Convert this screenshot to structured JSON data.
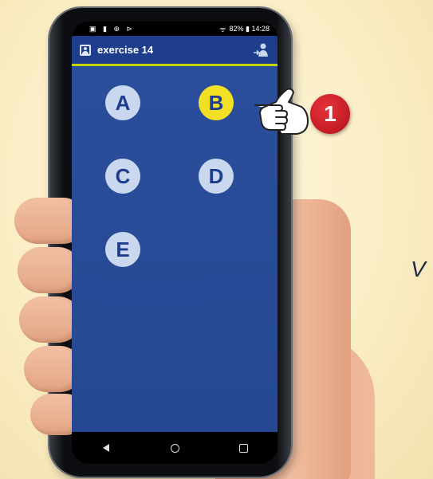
{
  "status_bar": {
    "left_icons": "▣ ▮ ⊕ ⊳",
    "right_text": "82% ▮ 14:28"
  },
  "app_bar": {
    "title": "exercise 14",
    "left_icon": "user-square-icon",
    "right_icon": "join-user-icon"
  },
  "choices": [
    {
      "label": "A",
      "selected": false
    },
    {
      "label": "B",
      "selected": true
    },
    {
      "label": "C",
      "selected": false
    },
    {
      "label": "D",
      "selected": false
    },
    {
      "label": "E",
      "selected": false
    }
  ],
  "callout": {
    "number": "1"
  },
  "background_text": "V",
  "colors": {
    "app_blue": "#264892",
    "header_blue": "#1e3d8c",
    "header_accent": "#c8d400",
    "choice_default": "#c9d8ee",
    "choice_selected": "#f2e025",
    "badge_red": "#d22630"
  },
  "nav_icons": [
    "back-icon",
    "home-icon",
    "recent-apps-icon"
  ]
}
